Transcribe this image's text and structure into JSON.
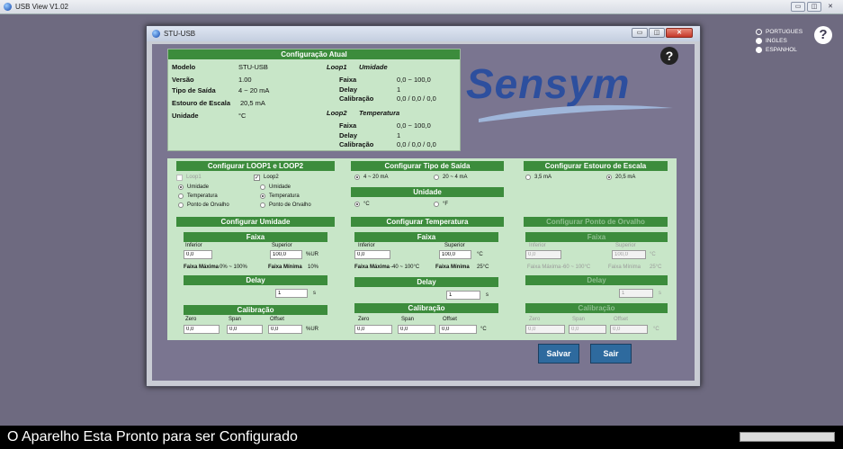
{
  "app": {
    "title": "USB View V1.02"
  },
  "languages": [
    {
      "label": "PORTUGUES",
      "selected": false
    },
    {
      "label": "INGLES",
      "selected": true
    },
    {
      "label": "ESPANHOL",
      "selected": true
    }
  ],
  "help_symbol": "?",
  "dialog": {
    "title": "STU-USB"
  },
  "current_config": {
    "header": "Configuração Atual",
    "modelo_label": "Modelo",
    "modelo_value": "STU-USB",
    "versao_label": "Versão",
    "versao_value": "1.00",
    "tipo_label": "Tipo de Saída",
    "tipo_value": "4 ~ 20 mA",
    "estouro_label": "Estouro de Escala",
    "estouro_value": "20,5 mA",
    "unidade_label": "Unidade",
    "unidade_value": "°C",
    "loop1_title": "Loop1",
    "loop1_sub": "Umidade",
    "loop1_faixa_label": "Faixa",
    "loop1_faixa": "0,0 ~ 100,0",
    "loop1_delay_label": "Delay",
    "loop1_delay": "1",
    "loop1_cal_label": "Calibração",
    "loop1_cal": "0,0 / 0,0 / 0,0",
    "loop2_title": "Loop2",
    "loop2_sub": "Temperatura",
    "loop2_faixa_label": "Faixa",
    "loop2_faixa": "0,0 ~ 100,0",
    "loop2_delay_label": "Delay",
    "loop2_delay": "1",
    "loop2_cal_label": "Calibração",
    "loop2_cal": "0,0 / 0,0 / 0,0"
  },
  "logo": {
    "text": "Sensym"
  },
  "loops_cfg": {
    "header": "Configurar LOOP1 e LOOP2",
    "loop1_label": "Loop1",
    "loop2_label": "Loop2",
    "opt_umidade": "Umidade",
    "opt_temperatura": "Temperatura",
    "opt_orvalho": "Ponto de Orvalho"
  },
  "saida_cfg": {
    "header": "Configurar Tipo de Saída",
    "opt1": "4 ~ 20 mA",
    "opt2": "20 ~ 4 mA"
  },
  "unidade_cfg": {
    "header": "Unidade",
    "opt1": "°C",
    "opt2": "°F"
  },
  "estouro_cfg": {
    "header": "Configurar Estouro de Escala",
    "opt1": "3,5 mA",
    "opt2": "20,5 mA"
  },
  "umidade_cfg": {
    "header": "Configurar Umidade",
    "faixa": "Faixa",
    "inferior_label": "Inferior",
    "inferior": "0,0",
    "superior_label": "Superior",
    "superior": "100,0",
    "unit": "%UR",
    "fmax_label": "Faixa Máxima",
    "fmax": "0% ~ 100%",
    "fmin_label": "Faixa Mínima",
    "fmin": "10%",
    "delay": "Delay",
    "delay_value": "1",
    "delay_unit": "s",
    "calibracao": "Calibração",
    "zero_label": "Zero",
    "zero": "0,0",
    "span_label": "Span",
    "span": "0,0",
    "offset_label": "Offset",
    "offset": "0,0",
    "cal_unit": "%UR"
  },
  "temperatura_cfg": {
    "header": "Configurar Temperatura",
    "faixa": "Faixa",
    "inferior_label": "Inferior",
    "inferior": "0,0",
    "superior_label": "Superior",
    "superior": "100,0",
    "unit": "°C",
    "fmax_label": "Faixa Máxima",
    "fmax": "-40 ~ 100°C",
    "fmin_label": "Faixa Mínima",
    "fmin": "25°C",
    "delay": "Delay",
    "delay_value": "1",
    "delay_unit": "s",
    "calibracao": "Calibração",
    "zero_label": "Zero",
    "zero": "0,0",
    "span_label": "Span",
    "span": "0,0",
    "offset_label": "Offset",
    "offset": "0,0",
    "cal_unit": "°C"
  },
  "orvalho_cfg": {
    "header": "Configurar Ponto de Orvalho",
    "faixa": "Faixa",
    "inferior_label": "Inferior",
    "inferior": "0,0",
    "superior_label": "Superior",
    "superior": "100,0",
    "unit": "°C",
    "fmax_label": "Faixa Máxima",
    "fmax": "-60 ~ 100°C",
    "fmin_label": "Faixa Mínima",
    "fmin": "25°C",
    "delay": "Delay",
    "delay_value": "1",
    "delay_unit": "s",
    "calibracao": "Calibração",
    "zero_label": "Zero",
    "zero": "0,0",
    "span_label": "Span",
    "span": "0,0",
    "offset_label": "Offset",
    "offset": "0,0",
    "cal_unit": "°C"
  },
  "buttons": {
    "salvar": "Salvar",
    "sair": "Sair"
  },
  "status": {
    "message": "O Aparelho Esta Pronto para ser Configurado"
  },
  "colors": {
    "panel_green": "#c8e6c8",
    "header_green": "#3c8c3c",
    "button_blue": "#2e6a9e",
    "logo_blue": "#2d4f9e"
  }
}
